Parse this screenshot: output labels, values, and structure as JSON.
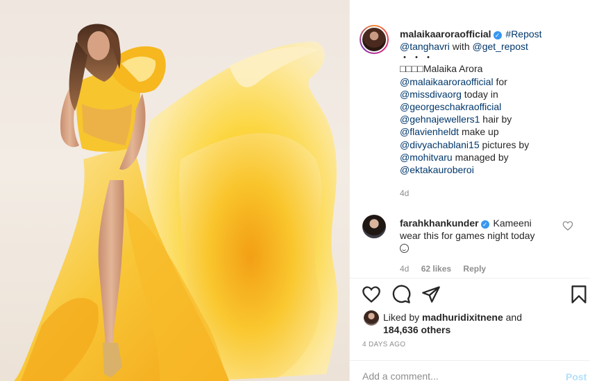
{
  "post": {
    "author": "malaikaaroraofficial",
    "caption_parts": {
      "repost_tag": "#Repost",
      "mention_source": "@tanghavri",
      "with_text": "with",
      "mention_tool": "@get_repost",
      "dots": "・・・",
      "title_line": "□□□□Malaika Arora",
      "mention_self": "@malaikaaroraofficial",
      "for_text": "for",
      "mention_diva": "@missdivaorg",
      "today_in": "today in",
      "mention_designer": "@georgeschakraofficial",
      "mention_jewels": "@gehnajewellers1",
      "hair_by": "hair by",
      "mention_hair": "@flavienheldt",
      "makeup": "make up",
      "mention_makeup": "@divyachablani15",
      "pictures_by": "pictures by",
      "mention_photo": "@mohitvaru",
      "managed_by": "managed by",
      "mention_manager": "@ektakauroberoi"
    },
    "age": "4d"
  },
  "comment": {
    "author": "farahkhankunder",
    "text_line1": "Kameeni",
    "text_rest": "wear this for games night today",
    "age": "4d",
    "likes": "62 likes",
    "reply_label": "Reply"
  },
  "likes": {
    "prefix": "Liked by",
    "user": "madhuridixitnene",
    "and_text": "and",
    "others": "184,636 others"
  },
  "timestamp": "4 DAYS AGO",
  "add_comment": {
    "placeholder": "Add a comment..."
  },
  "post_button_label": "Post",
  "icons": {
    "like": "heart-icon",
    "comment": "comment-bubble-icon",
    "share": "paper-plane-icon",
    "save": "bookmark-icon",
    "verified": "verified-badge-icon",
    "comment_like": "heart-outline-icon"
  },
  "colors": {
    "mention": "#00376b",
    "verified": "#3897f0",
    "muted": "#8e8e8e",
    "post_disabled": "#b2dffc"
  }
}
